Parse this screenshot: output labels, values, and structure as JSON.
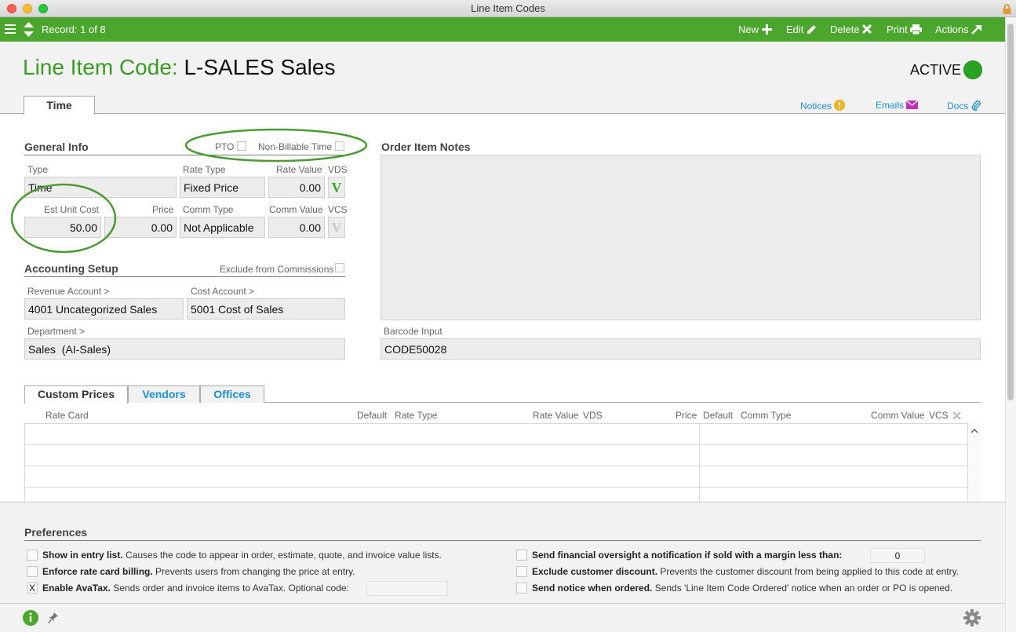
{
  "window": {
    "title": "Line Item Codes"
  },
  "toolbar": {
    "record_text": "Record: 1 of 8",
    "new_label": "New",
    "edit_label": "Edit",
    "delete_label": "Delete",
    "print_label": "Print",
    "actions_label": "Actions"
  },
  "header": {
    "prefix": "Line Item Code:",
    "value": "L-SALES Sales",
    "status": "ACTIVE",
    "status_color": "#27a31f"
  },
  "tabs": {
    "main": "Time"
  },
  "links": {
    "notices": "Notices",
    "emails": "Emails",
    "docs": "Docs"
  },
  "general_info": {
    "title": "General Info",
    "pto_label": "PTO",
    "non_billable_label": "Non-Billable Time",
    "type_label": "Type",
    "type_value": "Time",
    "rate_type_label": "Rate Type",
    "rate_type_value": "Fixed Price",
    "rate_value_label": "Rate Value",
    "rate_value": "0.00",
    "vds_label": "VDS",
    "vds_value": "V",
    "est_unit_cost_label": "Est Unit Cost",
    "est_unit_cost": "50.00",
    "price_label": "Price",
    "price": "0.00",
    "comm_type_label": "Comm Type",
    "comm_type_value": "Not Applicable",
    "comm_value_label": "Comm Value",
    "comm_value": "0.00",
    "vcs_label": "VCS",
    "vcs_value": "V"
  },
  "accounting": {
    "title": "Accounting Setup",
    "exclude_label": "Exclude from Commissions",
    "revenue_label": "Revenue Account >",
    "revenue_value": "4001 Uncategorized Sales",
    "cost_label": "Cost Account >",
    "cost_value": "5001 Cost of Sales",
    "department_label": "Department >",
    "department_value": "Sales  (AI-Sales)"
  },
  "notes": {
    "title": "Order Item Notes",
    "barcode_label": "Barcode Input",
    "barcode_value": "CODE50028"
  },
  "subtabs": [
    "Custom Prices",
    "Vendors",
    "Offices"
  ],
  "table": {
    "columns": [
      "Rate Card",
      "Default",
      "Rate Type",
      "Rate Value",
      "VDS",
      "Price",
      "Default",
      "Comm Type",
      "Comm Value",
      "VCS"
    ]
  },
  "preferences": {
    "title": "Preferences",
    "items": [
      {
        "bold": "Show in entry list.",
        "text": " Causes the code to appear in order, estimate, quote, and invoice value lists.",
        "checked": ""
      },
      {
        "bold": "Enforce rate card billing.",
        "text": " Prevents users from changing the price at entry.",
        "checked": ""
      },
      {
        "bold": "Enable AvaTax.",
        "text": " Sends order and invoice items to AvaTax. Optional code:",
        "checked": "X"
      },
      {
        "bold": "Send financial oversight a notification if sold with a margin less than:",
        "text": "",
        "checked": ""
      },
      {
        "bold": "Exclude customer discount.",
        "text": " Prevents the customer discount from being applied to this code at entry.",
        "checked": ""
      },
      {
        "bold": "Send notice when ordered.",
        "text": " Sends 'Line Item Code Ordered' notice when an order or PO is opened.",
        "checked": ""
      }
    ],
    "margin_value": "0"
  },
  "colors": {
    "brand_green": "#4aa62d",
    "link_blue": "#1a8fd1"
  }
}
